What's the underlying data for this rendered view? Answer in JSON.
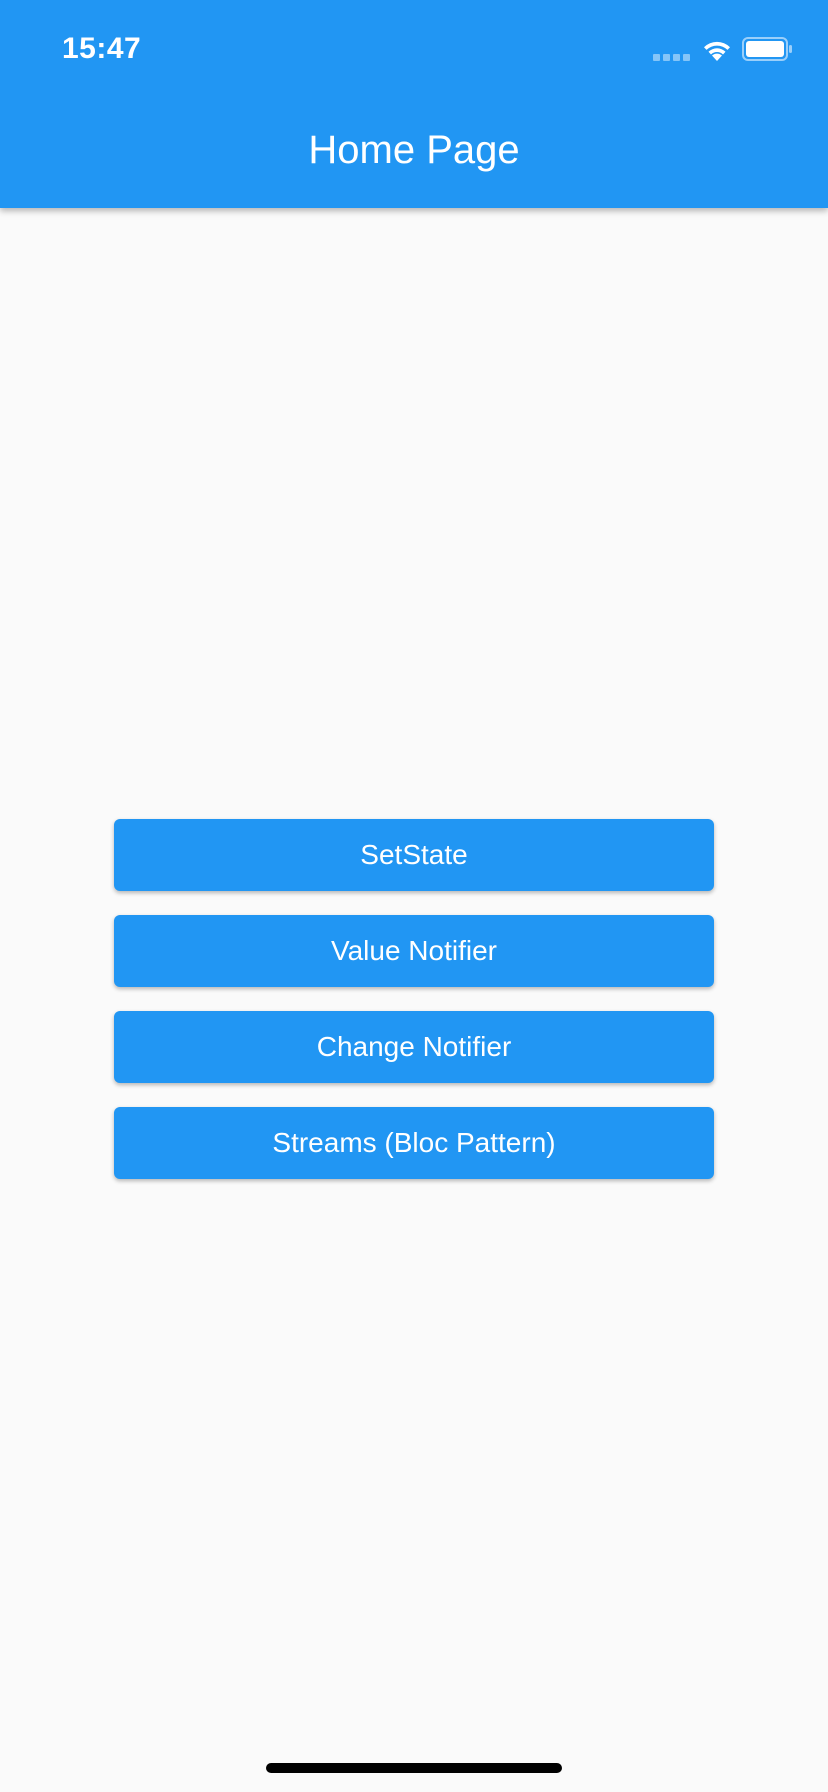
{
  "status_bar": {
    "time": "15:47"
  },
  "app_bar": {
    "title": "Home Page",
    "color": "#2196f3"
  },
  "buttons": [
    {
      "label": "SetState"
    },
    {
      "label": "Value Notifier"
    },
    {
      "label": "Change Notifier"
    },
    {
      "label": "Streams (Bloc Pattern)"
    }
  ],
  "icons": {
    "signal": "cellular-signal-icon",
    "wifi": "wifi-icon",
    "battery": "battery-icon"
  },
  "colors": {
    "background": "#fafafa",
    "accent": "#2196f3",
    "text_on_accent": "#ffffff"
  }
}
